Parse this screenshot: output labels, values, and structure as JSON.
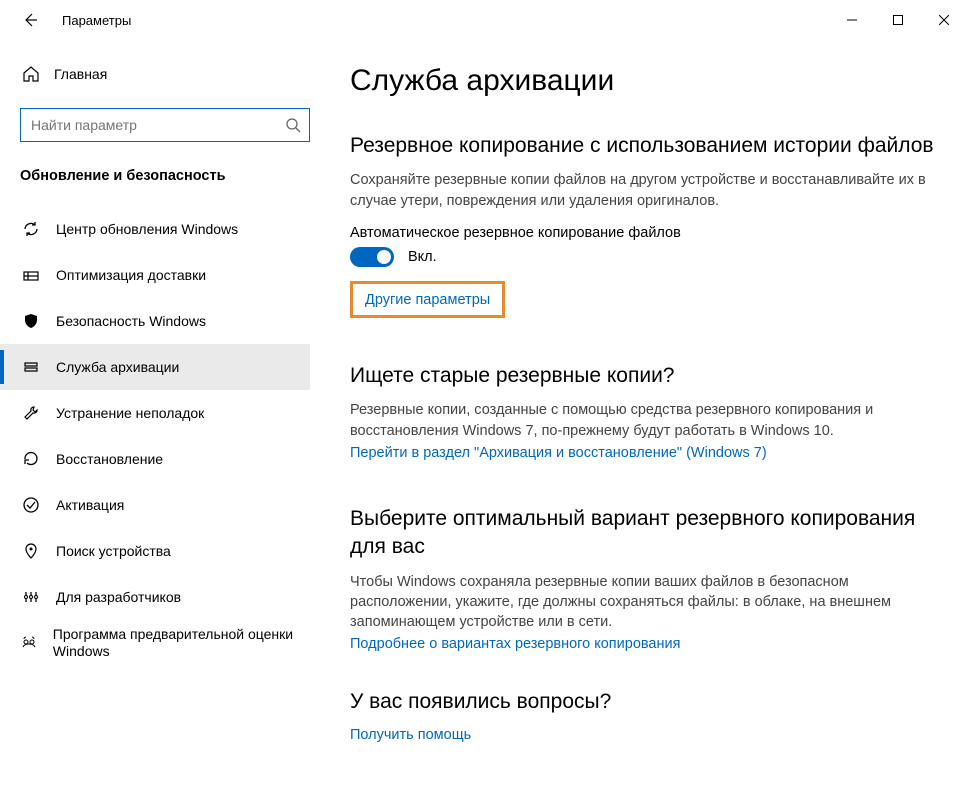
{
  "window": {
    "title": "Параметры"
  },
  "sidebar": {
    "home_label": "Главная",
    "search_placeholder": "Найти параметр",
    "section_title": "Обновление и безопасность",
    "items": [
      {
        "label": "Центр обновления Windows"
      },
      {
        "label": "Оптимизация доставки"
      },
      {
        "label": "Безопасность Windows"
      },
      {
        "label": "Служба архивации"
      },
      {
        "label": "Устранение неполадок"
      },
      {
        "label": "Восстановление"
      },
      {
        "label": "Активация"
      },
      {
        "label": "Поиск устройства"
      },
      {
        "label": "Для разработчиков"
      },
      {
        "label": "Программа предварительной оценки Windows"
      }
    ]
  },
  "content": {
    "page_title": "Служба архивации",
    "section1": {
      "heading": "Резервное копирование с использованием истории файлов",
      "desc": "Сохраняйте резервные копии файлов на другом устройстве и восстанавливайте их в случае утери, повреждения или удаления оригиналов.",
      "toggle_label": "Автоматическое резервное копирование файлов",
      "toggle_state": "Вкл.",
      "more_options": "Другие параметры"
    },
    "section2": {
      "heading": "Ищете старые резервные копии?",
      "desc": "Резервные копии, созданные с помощью средства резервного копирования и восстановления Windows 7, по-прежнему будут работать в Windows 10.",
      "link": "Перейти в раздел \"Архивация и восстановление\" (Windows 7)"
    },
    "section3": {
      "heading": "Выберите оптимальный вариант резервного копирования для вас",
      "desc": "Чтобы Windows сохраняла резервные копии ваших файлов в безопасном расположении, укажите, где должны сохраняться файлы: в облаке, на внешнем запоминающем устройстве или в сети.",
      "link": "Подробнее о вариантах резервного копирования"
    },
    "section4": {
      "heading": "У вас появились вопросы?",
      "link": "Получить помощь"
    }
  }
}
